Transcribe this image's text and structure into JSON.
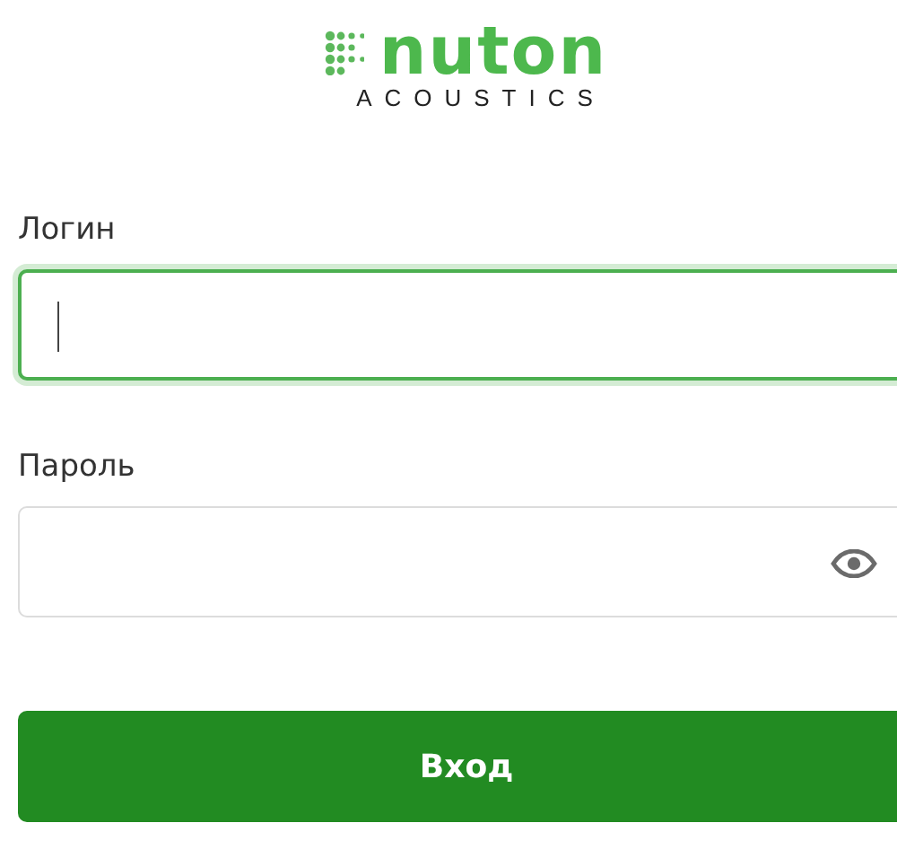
{
  "logo": {
    "name": "nuton",
    "tagline": "ACOUSTICS"
  },
  "fields": [
    {
      "label": "Логин",
      "kind": "text",
      "focused": true
    },
    {
      "label": "Пароль",
      "kind": "password",
      "focused": false
    }
  ],
  "submit_button": {
    "label": "Вход"
  }
}
